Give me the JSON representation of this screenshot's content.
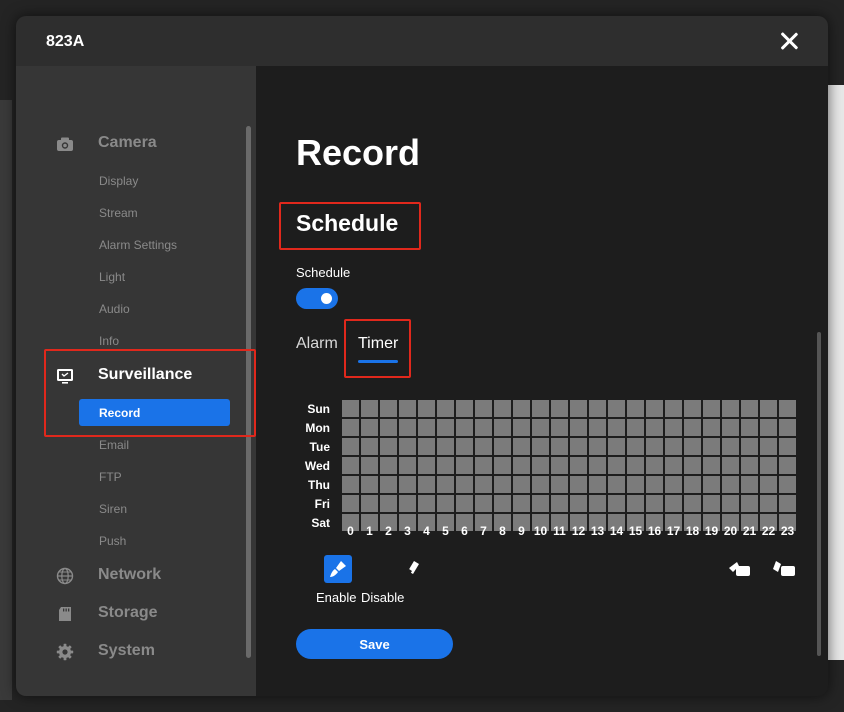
{
  "window": {
    "title": "823A"
  },
  "sidebar": {
    "camera": {
      "label": "Camera",
      "items": [
        "Display",
        "Stream",
        "Alarm Settings",
        "Light",
        "Audio",
        "Info"
      ]
    },
    "surveillance": {
      "label": "Surveillance",
      "active_item": "Record",
      "items": [
        "Email",
        "FTP",
        "Siren",
        "Push"
      ]
    },
    "network": {
      "label": "Network"
    },
    "storage": {
      "label": "Storage"
    },
    "system": {
      "label": "System"
    }
  },
  "main": {
    "page_title": "Record",
    "section_title": "Schedule",
    "schedule_toggle": {
      "label": "Schedule",
      "on": true
    },
    "tabs": [
      {
        "label": "Alarm",
        "active": false
      },
      {
        "label": "Timer",
        "active": true
      }
    ],
    "days": [
      "Sun",
      "Mon",
      "Tue",
      "Wed",
      "Thu",
      "Fri",
      "Sat"
    ],
    "hours": [
      "0",
      "1",
      "2",
      "3",
      "4",
      "5",
      "6",
      "7",
      "8",
      "9",
      "10",
      "11",
      "12",
      "13",
      "14",
      "15",
      "16",
      "17",
      "18",
      "19",
      "20",
      "21",
      "22",
      "23"
    ],
    "tools": {
      "enable_label": "Enable",
      "disable_label": "Disable"
    },
    "save_label": "Save"
  },
  "colors": {
    "accent": "#1a73e8",
    "highlight": "#e0281c",
    "grid_cell": "#7b7b7b",
    "sidebar_bg": "#363636",
    "main_bg": "#1d1d1d"
  }
}
